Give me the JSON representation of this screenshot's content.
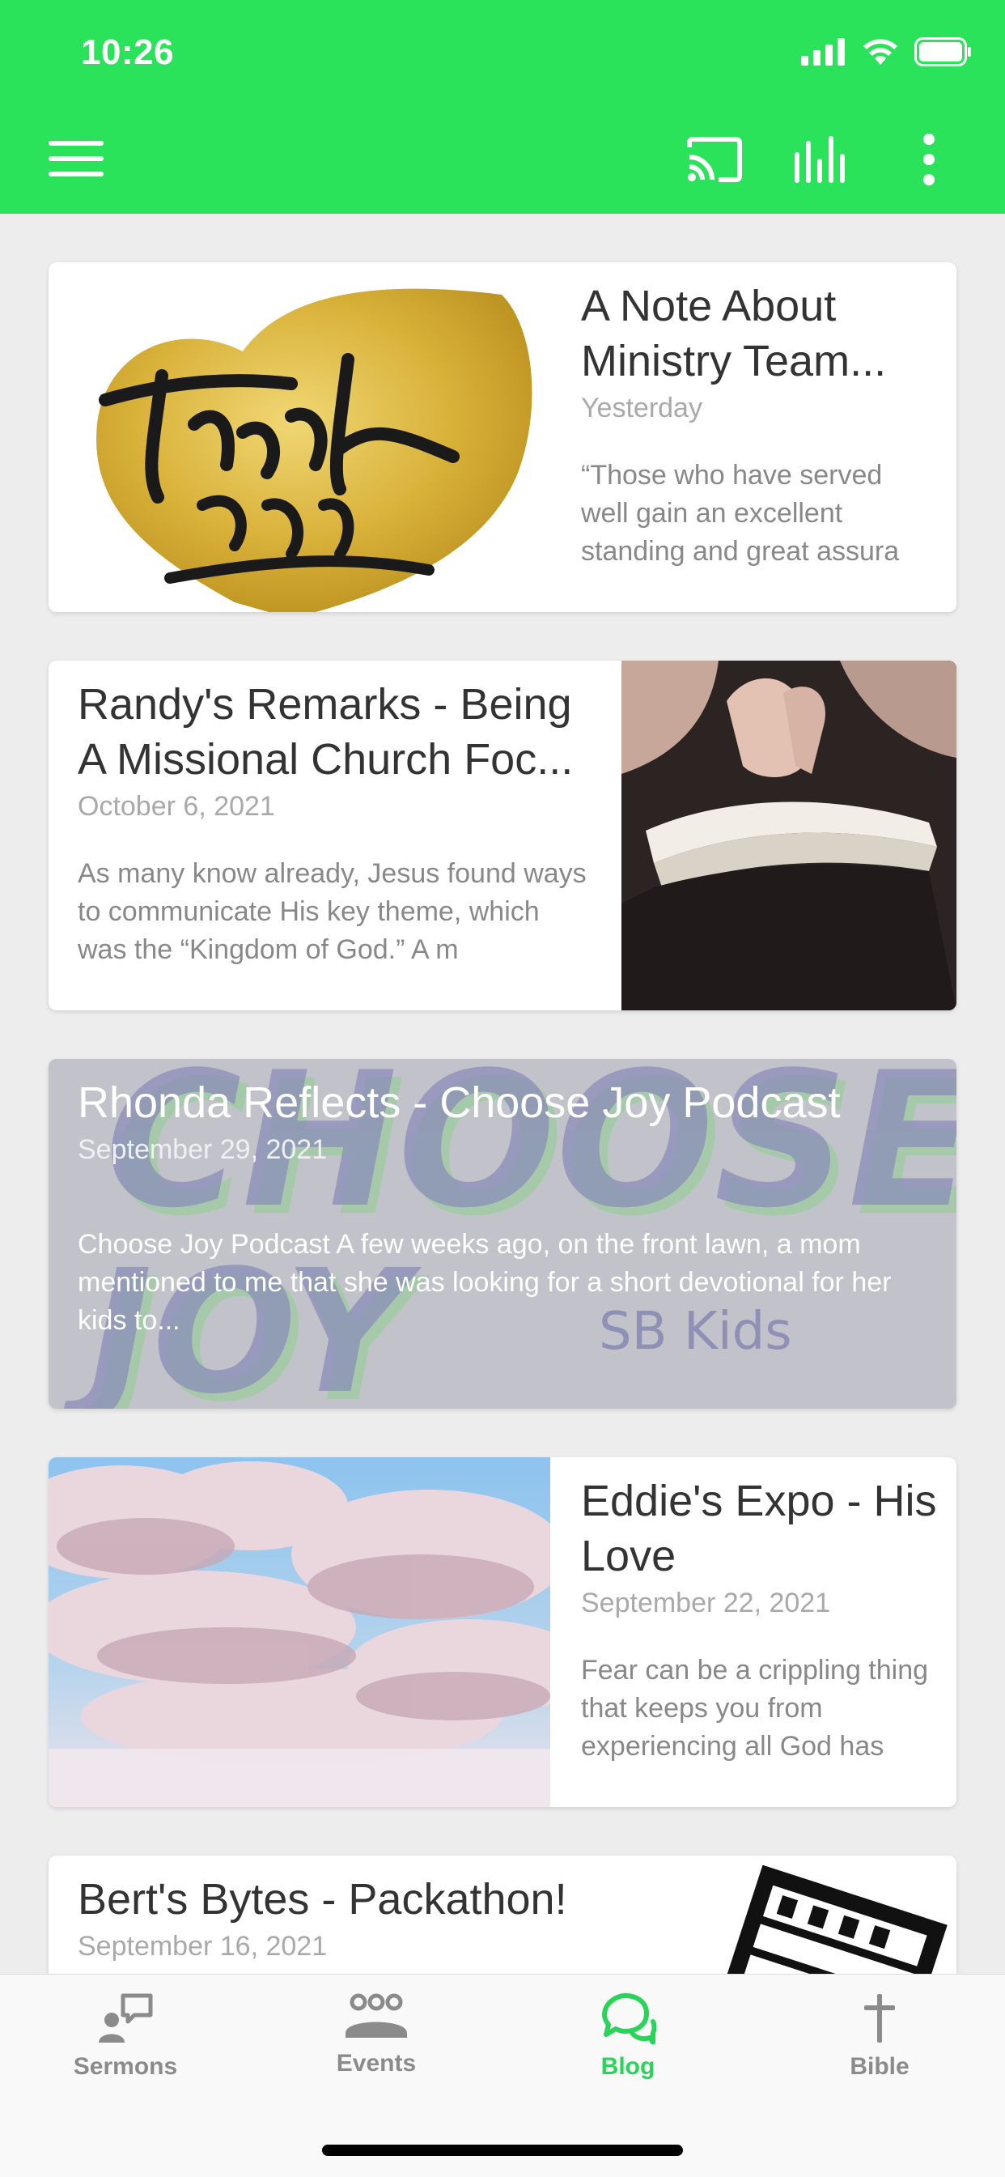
{
  "status_bar": {
    "time": "10:26"
  },
  "toolbar": {
    "menu_icon": "hamburger-menu-icon",
    "cast_icon": "cast-icon",
    "audio_icon": "equalizer-icon",
    "more_icon": "more-vertical-icon",
    "background_color": "#2ae35a"
  },
  "posts": [
    {
      "title": "A Note About Ministry Team...",
      "date": "Yesterday",
      "excerpt": "“Those who have served well gain an excellent standing and great assura",
      "image": "thank-you-gold-heart"
    },
    {
      "title": "Randy's Remarks - Being A Missional Church Foc...",
      "date": "October 6, 2021",
      "excerpt": "As many know already, Jesus found ways to communicate His key theme, which was the “Kingdom of God.” A m",
      "image": "praying-hands-bible"
    },
    {
      "title": "Rhonda Reflects - Choose Joy Podcast",
      "date": "September 29, 2021",
      "excerpt": "Choose Joy Podcast A few weeks ago, on the front lawn, a mom mentioned to me that she was looking for a short devotional for her kids to...",
      "image_text": {
        "line1": "CHOOSE",
        "line2": "JOY",
        "tag": "SB Kids"
      }
    },
    {
      "title": "Eddie's Expo - His Love",
      "date": "September 22, 2021",
      "excerpt": "Fear can be a crippling thing that keeps you from experiencing all God has",
      "image": "clouds-sky"
    },
    {
      "title": "Bert's Bytes - Packathon!",
      "date": "September 16, 2021",
      "image": "feed-stamp-graphic"
    }
  ],
  "tabs": [
    {
      "label": "Sermons",
      "icon": "sermons-icon",
      "active": false
    },
    {
      "label": "Events",
      "icon": "events-icon",
      "active": false
    },
    {
      "label": "Blog",
      "icon": "blog-icon",
      "active": true
    },
    {
      "label": "Bible",
      "icon": "cross-icon",
      "active": false
    }
  ],
  "colors": {
    "accent": "#2ad45a",
    "tab_inactive": "#8b8b8b"
  }
}
